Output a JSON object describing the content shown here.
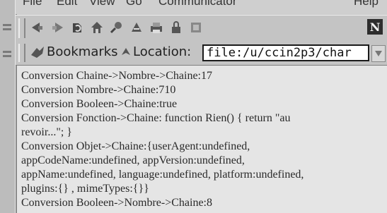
{
  "menu": [
    "File",
    "Edit",
    "View",
    "Go",
    "Communicator",
    "Help"
  ],
  "toolbar": {
    "buttons": [
      "back-icon",
      "forward-icon",
      "reload-icon",
      "home-icon",
      "search-icon",
      "netscape-guide-icon",
      "print-icon",
      "security-icon",
      "stop-icon"
    ],
    "logo": "N"
  },
  "location_bar": {
    "bookmarks_label": "Bookmarks",
    "location_label": "Location:",
    "url": "file:/u/ccin2p3/char"
  },
  "content_lines": [
    "Conversion Chaine->Nombre->Chaine:17",
    "Conversion Nombre->Chaine:710",
    "Conversion Booleen->Chaine:true",
    "Conversion Fonction->Chaine: function Rien() { return \"au",
    "revoir...\"; }",
    "Conversion Objet->Chaine:{userAgent:undefined,",
    "appCodeName:undefined, appVersion:undefined,",
    "appName:undefined, language:undefined, platform:undefined,",
    "plugins:{} , mimeTypes:{}}",
    "Conversion Booleen->Nombre->Chaine:8"
  ],
  "colors": {
    "chrome": "#c4c4c4",
    "content_bg": "#e5e5e5",
    "text": "#2a2a2a"
  }
}
